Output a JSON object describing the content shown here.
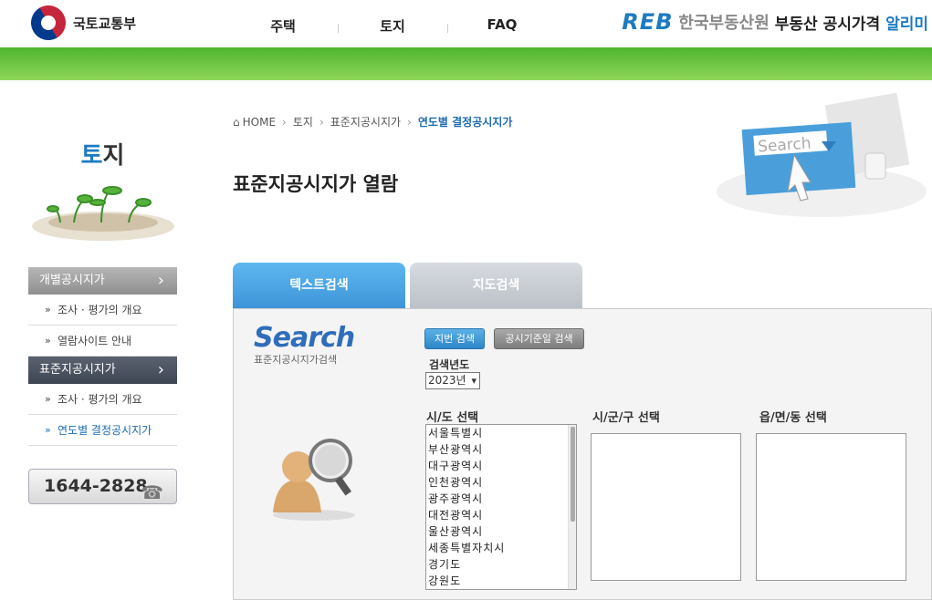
{
  "header": {
    "ministry": "국토교통부",
    "nav": [
      "주택",
      "토지",
      "FAQ"
    ],
    "brand_logo": "REB",
    "brand_org": "한국부동산원",
    "brand_service": "부동산 공시가격",
    "brand_service_accent": "알리미"
  },
  "sidebar": {
    "section_title_first": "토",
    "section_title_rest": "지",
    "groups": [
      {
        "title": "개별공시지가",
        "items": [
          "조사 · 평가의 개요",
          "열람사이트 안내"
        ]
      },
      {
        "title": "표준지공시지가",
        "items": [
          "조사 · 평가의 개요",
          "연도별 결정공시지가"
        ]
      }
    ],
    "phone": "1644-2828"
  },
  "breadcrumb": [
    "HOME",
    "토지",
    "표준지공시지가",
    "연도별 결정공시지가"
  ],
  "page_title": "표준지공시지가 열람",
  "deco_search_text": "Search",
  "tabs": [
    "텍스트검색",
    "지도검색"
  ],
  "search": {
    "logo_big": "Search",
    "logo_small": "표준지공시지가검색",
    "buttons": [
      "지번 검색",
      "공시기준일 검색"
    ],
    "year_label": "검색년도",
    "year_value": "2023년",
    "sido_label": "시/도 선택",
    "sigungu_label": "시/군/구 선택",
    "dong_label": "읍/면/동 선택",
    "sido_options": [
      "서울특별시",
      "부산광역시",
      "대구광역시",
      "인천광역시",
      "광주광역시",
      "대전광역시",
      "울산광역시",
      "세종특별자치시",
      "경기도",
      "강원도"
    ]
  },
  "colors": {
    "accent": "#1c7bc0",
    "green": "#5cbd35",
    "tab_active": "#4aa5e4"
  }
}
